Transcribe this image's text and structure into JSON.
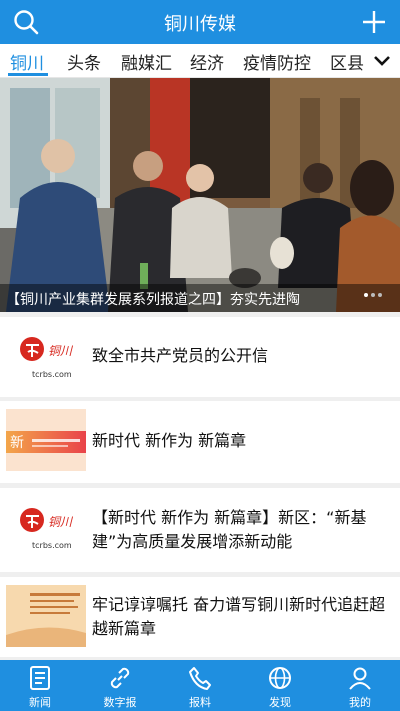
{
  "header": {
    "title": "铜川传媒",
    "search_icon": "search-icon",
    "add_icon": "plus-icon"
  },
  "tabs": [
    {
      "label": "铜川",
      "active": true
    },
    {
      "label": "头条"
    },
    {
      "label": "融媒汇"
    },
    {
      "label": "经济"
    },
    {
      "label": "疫情防控"
    },
    {
      "label": "区县"
    }
  ],
  "banner": {
    "caption": "【铜川产业集群发展系列报道之四】夯实先进陶"
  },
  "news": [
    {
      "title": "致全市共产党员的公开信",
      "thumb_site": "tcrbs.com",
      "thumb_logo": "铜川传媒"
    },
    {
      "title": "新时代 新作为 新篇章",
      "thumb_banner": "新时代 新作为 新篇章"
    },
    {
      "title": "【新时代 新作为 新篇章】新区：“新基建”为高质量发展增添新动能",
      "thumb_site": "tcrbs.com",
      "thumb_logo": "铜川传媒"
    },
    {
      "title": "牢记谆谆嘱托 奋力谱写铜川新时代追赶超越新篇章"
    }
  ],
  "bottom_nav": [
    {
      "label": "新闻",
      "icon": "newspaper-icon",
      "active": true
    },
    {
      "label": "数字报",
      "icon": "link-icon"
    },
    {
      "label": "报料",
      "icon": "phone-icon"
    },
    {
      "label": "发现",
      "icon": "globe-icon"
    },
    {
      "label": "我的",
      "icon": "user-icon"
    }
  ],
  "colors": {
    "brand": "#1f8fe0",
    "logo_red": "#d7281f"
  }
}
